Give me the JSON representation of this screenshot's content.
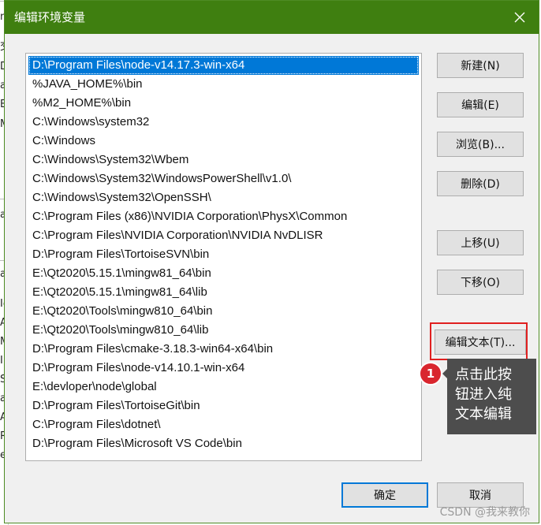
{
  "dialog": {
    "title": "编辑环境变量",
    "close_icon": "close-icon"
  },
  "background_window": {
    "chars": [
      "m",
      "交",
      "Dr",
      "a",
      "E",
      "M",
      "a",
      "a",
      "Ie",
      "交",
      "A",
      "M",
      "IU",
      "S",
      "a",
      "A",
      "R",
      "e"
    ]
  },
  "path_list": {
    "selected_index": 0,
    "items": [
      "D:\\Program Files\\node-v14.17.3-win-x64",
      "%JAVA_HOME%\\bin",
      "%M2_HOME%\\bin",
      "C:\\Windows\\system32",
      "C:\\Windows",
      "C:\\Windows\\System32\\Wbem",
      "C:\\Windows\\System32\\WindowsPowerShell\\v1.0\\",
      "C:\\Windows\\System32\\OpenSSH\\",
      "C:\\Program Files (x86)\\NVIDIA Corporation\\PhysX\\Common",
      "C:\\Program Files\\NVIDIA Corporation\\NVIDIA NvDLISR",
      "D:\\Program Files\\TortoiseSVN\\bin",
      "E:\\Qt2020\\5.15.1\\mingw81_64\\bin",
      "E:\\Qt2020\\5.15.1\\mingw81_64\\lib",
      "E:\\Qt2020\\Tools\\mingw810_64\\bin",
      "E:\\Qt2020\\Tools\\mingw810_64\\lib",
      "D:\\Program Files\\cmake-3.18.3-win64-x64\\bin",
      "D:\\Program Files\\node-v14.10.1-win-x64",
      "E:\\devloper\\node\\global",
      "D:\\Program Files\\TortoiseGit\\bin",
      "C:\\Program Files\\dotnet\\",
      "D:\\Program Files\\Microsoft VS Code\\bin"
    ]
  },
  "buttons": {
    "new": "新建(N)",
    "edit": "编辑(E)",
    "browse": "浏览(B)...",
    "delete": "删除(D)",
    "move_up": "上移(U)",
    "move_down": "下移(O)",
    "edit_text": "编辑文本(T)...",
    "ok": "确定",
    "cancel": "取消"
  },
  "annotation": {
    "badge": "1",
    "lines": [
      "点击此按",
      "钮进入纯",
      "文本编辑"
    ]
  },
  "watermark": "CSDN @我来教你",
  "colors": {
    "titlebar": "#3f7f10",
    "selection": "#0078d7",
    "highlight": "#e02020",
    "callout": "#4d4d4d"
  }
}
